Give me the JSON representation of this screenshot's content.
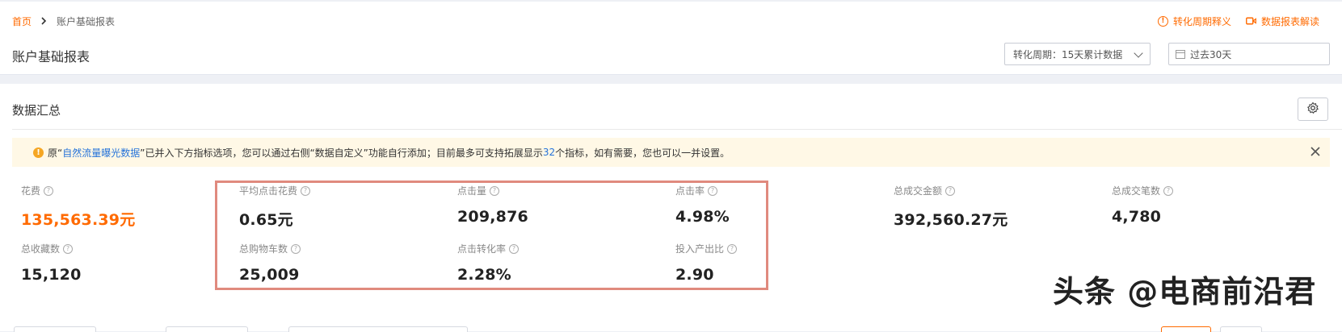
{
  "breadcrumb": {
    "home": "首页",
    "current": "账户基础报表"
  },
  "top_links": [
    {
      "label": "转化周期释义",
      "icon": "info-circle-icon"
    },
    {
      "label": "数据报表解读",
      "icon": "video-icon"
    }
  ],
  "page_title": "账户基础报表",
  "filters": {
    "period_select": "转化周期：15天累计数据",
    "date_range": "过去30天"
  },
  "section": {
    "title": "数据汇总",
    "settings_icon": "gear-icon"
  },
  "notice": {
    "prefix": "原“",
    "link": "自然流量曝光数据",
    "middle": "”已并入下方指标选项，您可以通过右侧“数据自定义”功能自行添加；目前最多可支持拓展显示",
    "count": "32",
    "suffix": "个指标，如有需要，您也可以一并设置。"
  },
  "metrics": [
    {
      "label": "花费",
      "value": "135,563.39元",
      "accent": true
    },
    {
      "label": "平均点击花费",
      "value": "0.65元"
    },
    {
      "label": "点击量",
      "value": "209,876"
    },
    {
      "label": "点击率",
      "value": "4.98%"
    },
    {
      "label": "总成交金额",
      "value": "392,560.27元"
    },
    {
      "label": "总成交笔数",
      "value": "4,780"
    },
    {
      "label": "总收藏数",
      "value": "15,120"
    },
    {
      "label": "总购物车数",
      "value": "25,009"
    },
    {
      "label": "点击转化率",
      "value": "2.28%"
    },
    {
      "label": "投入产出比",
      "value": "2.90"
    }
  ],
  "watermark": "头条 @电商前沿君",
  "colors": {
    "accent": "#ff6a00",
    "link": "#2673d9",
    "highlight_border": "#e08a7e",
    "notice_bg": "#fff8e6"
  }
}
